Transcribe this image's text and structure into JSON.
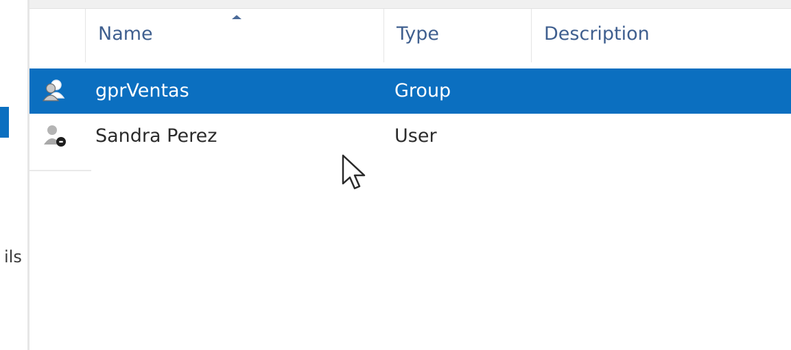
{
  "nav": {
    "partial_label": "ils",
    "selection_color": "#0b6fc0"
  },
  "list": {
    "columns": [
      {
        "key": "icon",
        "label": ""
      },
      {
        "key": "name",
        "label": "Name",
        "sorted": "ascending"
      },
      {
        "key": "type",
        "label": "Type"
      },
      {
        "key": "description",
        "label": "Description"
      }
    ],
    "rows": [
      {
        "icon": "group-icon",
        "name": "gprVentas",
        "type": "Group",
        "description": "",
        "selected": true
      },
      {
        "icon": "user-disabled-icon",
        "name": "Sandra Perez",
        "type": "User",
        "description": "",
        "selected": false
      }
    ]
  },
  "colors": {
    "selection_bg": "#0b6fc0",
    "header_text": "#3f5f8f",
    "row_text": "#2b2b2b"
  },
  "cursor": {
    "icon": "mouse-pointer-icon"
  }
}
